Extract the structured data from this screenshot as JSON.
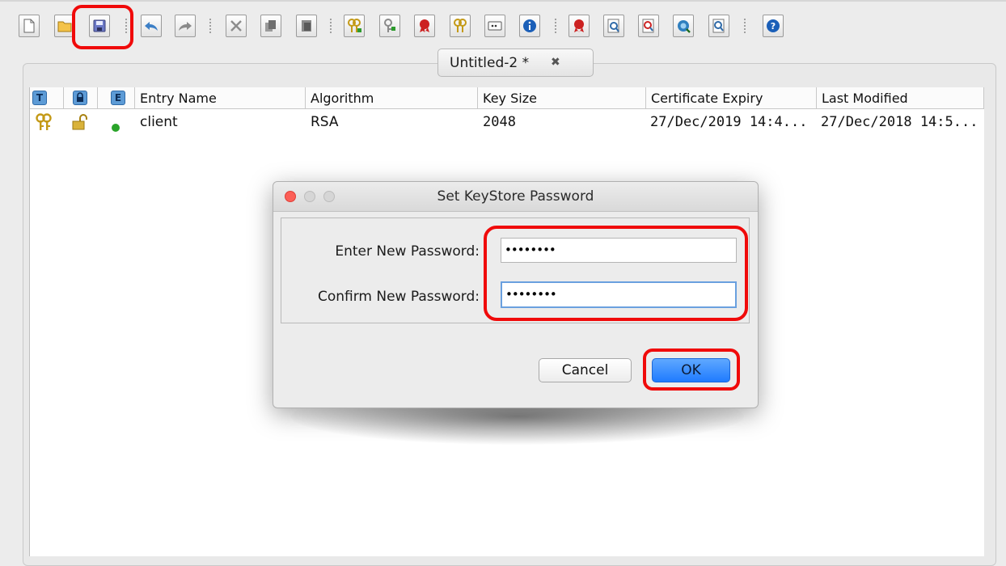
{
  "toolbar": {
    "buttons": [
      "new-icon",
      "open-icon",
      "save-icon",
      "undo-icon",
      "redo-icon",
      "cut-icon",
      "copy-icon",
      "paste-icon",
      "generate-keypair-icon",
      "generate-secret-key-icon",
      "import-trusted-cert-icon",
      "import-keypair-icon",
      "set-password-icon",
      "properties-icon",
      "examine-file-icon",
      "examine-clipboard-icon",
      "examine-ssl-icon",
      "examine-csr-icon",
      "examine-crl-icon",
      "help-icon"
    ],
    "highlight_color": "#f00a0a"
  },
  "tab": {
    "title": "Untitled-2 *",
    "close": "✖"
  },
  "table": {
    "header_icons": [
      "T",
      "",
      "E"
    ],
    "columns": [
      "Entry Name",
      "Algorithm",
      "Key Size",
      "Certificate Expiry",
      "Last Modified"
    ],
    "rows": [
      {
        "name": "client",
        "algorithm": "RSA",
        "key_size": "2048",
        "expiry": "27/Dec/2019 14:4...",
        "modified": "27/Dec/2018 14:5..."
      }
    ]
  },
  "dialog": {
    "title": "Set KeyStore Password",
    "new_password_label": "Enter New Password:",
    "new_password_value": "••••••••",
    "confirm_password_label": "Confirm New Password:",
    "confirm_password_value": "••••••••",
    "cancel_label": "Cancel",
    "ok_label": "OK"
  }
}
